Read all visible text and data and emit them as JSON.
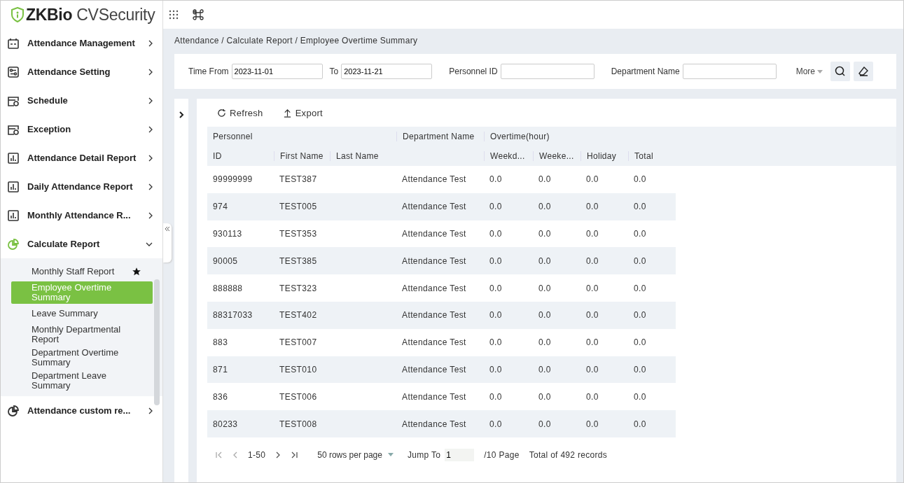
{
  "logo": {
    "brand": "ZKBio",
    "product": " CVSecurity"
  },
  "sidebar": {
    "items": [
      {
        "label": "Attendance Management",
        "expanded": false
      },
      {
        "label": "Attendance Setting",
        "expanded": false
      },
      {
        "label": "Schedule",
        "expanded": false
      },
      {
        "label": "Exception",
        "expanded": false
      },
      {
        "label": "Attendance Detail Report",
        "expanded": false
      },
      {
        "label": "Daily Attendance Report",
        "expanded": false
      },
      {
        "label": "Monthly Attendance R...",
        "expanded": false
      },
      {
        "label": "Calculate Report",
        "expanded": true,
        "children": [
          {
            "label": "Monthly Staff Report",
            "selected": false,
            "starred": true
          },
          {
            "label": "Employee Overtime Summary",
            "selected": true,
            "starred": false
          },
          {
            "label": "Leave Summary",
            "selected": false,
            "starred": false
          },
          {
            "label": "Monthly Departmental Report",
            "selected": false,
            "starred": false
          },
          {
            "label": "Department Overtime Summary",
            "selected": false,
            "starred": false
          },
          {
            "label": "Department Leave Summary",
            "selected": false,
            "starred": false
          }
        ]
      },
      {
        "label": "Attendance custom re...",
        "expanded": false
      }
    ]
  },
  "breadcrumb": "Attendance / Calculate Report / Employee Overtime Summary",
  "filters": {
    "time_from_label": "Time From",
    "time_from": "2023-11-01",
    "to_label": "To",
    "to": "2023-11-21",
    "personnel_id_label": "Personnel ID",
    "department_label": "Department Name",
    "more": "More"
  },
  "toolbar": {
    "refresh": "Refresh",
    "export": "Export"
  },
  "table": {
    "groups": [
      "Personnel",
      "Department Name",
      "Overtime(hour)"
    ],
    "columns": [
      "ID",
      "First Name",
      "Last Name",
      "",
      "Weekd...",
      "Weeke...",
      "Holiday",
      "Total"
    ],
    "rows": [
      [
        "99999999",
        "TEST387",
        "",
        "Attendance Test",
        "0.0",
        "0.0",
        "0.0",
        "0.0"
      ],
      [
        "974",
        "TEST005",
        "",
        "Attendance Test",
        "0.0",
        "0.0",
        "0.0",
        "0.0"
      ],
      [
        "930113",
        "TEST353",
        "",
        "Attendance Test",
        "0.0",
        "0.0",
        "0.0",
        "0.0"
      ],
      [
        "90005",
        "TEST385",
        "",
        "Attendance Test",
        "0.0",
        "0.0",
        "0.0",
        "0.0"
      ],
      [
        "888888",
        "TEST323",
        "",
        "Attendance Test",
        "0.0",
        "0.0",
        "0.0",
        "0.0"
      ],
      [
        "88317033",
        "TEST402",
        "",
        "Attendance Test",
        "0.0",
        "0.0",
        "0.0",
        "0.0"
      ],
      [
        "883",
        "TEST007",
        "",
        "Attendance Test",
        "0.0",
        "0.0",
        "0.0",
        "0.0"
      ],
      [
        "871",
        "TEST010",
        "",
        "Attendance Test",
        "0.0",
        "0.0",
        "0.0",
        "0.0"
      ],
      [
        "836",
        "TEST006",
        "",
        "Attendance Test",
        "0.0",
        "0.0",
        "0.0",
        "0.0"
      ],
      [
        "80233",
        "TEST008",
        "",
        "Attendance Test",
        "0.0",
        "0.0",
        "0.0",
        "0.0"
      ]
    ]
  },
  "pagination": {
    "range": "1-50",
    "rows_per_page": "50 rows per page",
    "jump_label": "Jump To",
    "page": "1",
    "pages": "/10 Page",
    "total": "Total of 492 records"
  }
}
